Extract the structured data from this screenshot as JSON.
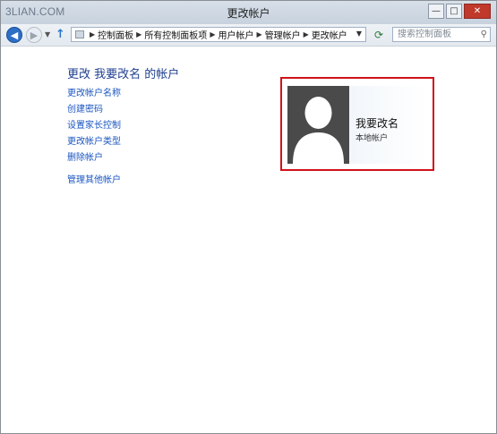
{
  "watermark": "3LIAN.COM",
  "window": {
    "title": "更改帐户",
    "buttons": {
      "minimize": "—",
      "maximize": "□",
      "close": "✕"
    }
  },
  "navbar": {
    "breadcrumb": [
      "控制面板",
      "所有控制面板项",
      "用户帐户",
      "管理帐户",
      "更改帐户"
    ],
    "search_placeholder": "搜索控制面板"
  },
  "main": {
    "heading": "更改 我要改名 的帐户",
    "links": [
      "更改帐户名称",
      "创建密码",
      "设置家长控制",
      "更改帐户类型",
      "删除帐户"
    ],
    "other_link": "管理其他帐户"
  },
  "account": {
    "name": "我要改名",
    "type": "本地帐户"
  },
  "colors": {
    "link": "#1a55c0",
    "heading": "#1f3f8f",
    "highlight_border": "#d0121b"
  }
}
